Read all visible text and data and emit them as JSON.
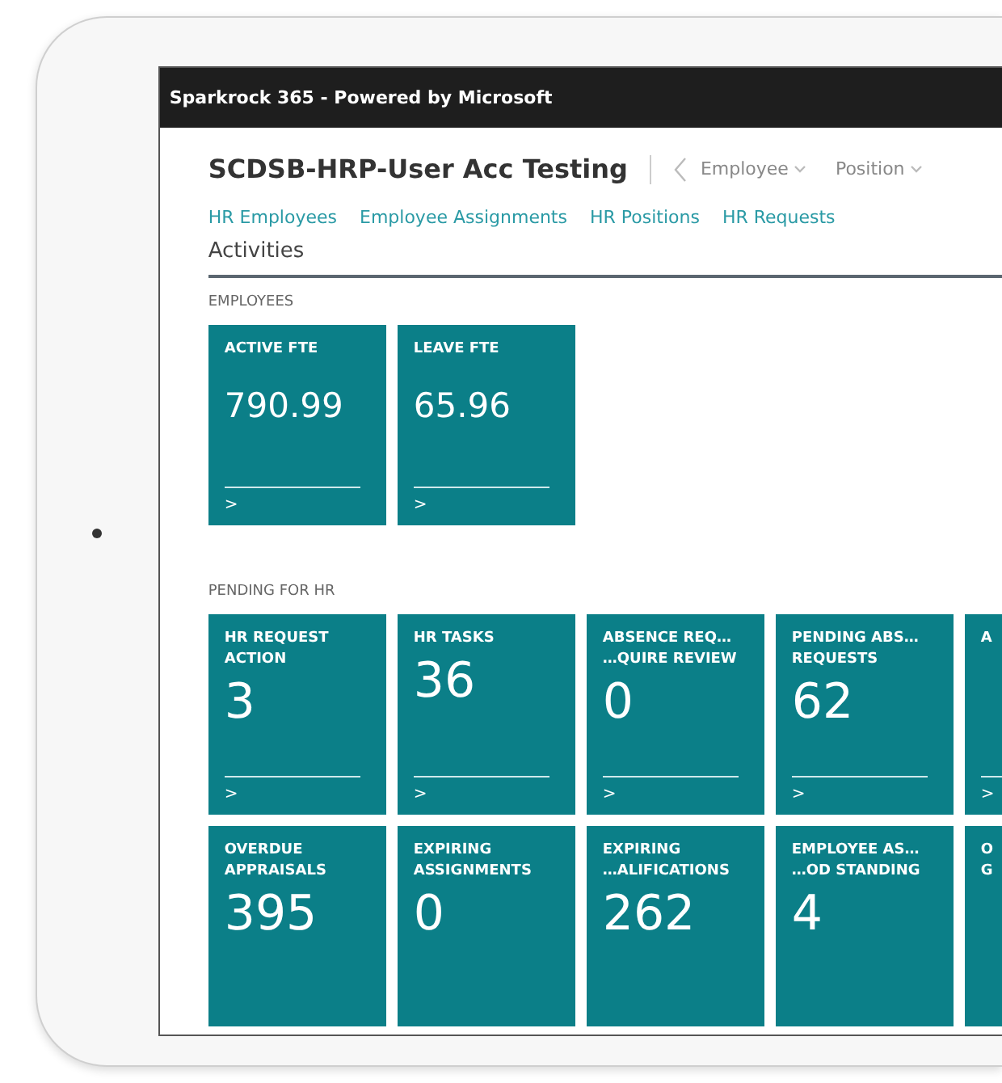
{
  "window": {
    "title": "Sparkrock 365 - Powered by Microsoft"
  },
  "header": {
    "company": "SCDSB-HRP-User Acc Testing",
    "menus": [
      {
        "label": "Employee"
      },
      {
        "label": "Position"
      }
    ]
  },
  "nav_links": [
    "HR Employees",
    "Employee Assignments",
    "HR Positions",
    "HR Requests"
  ],
  "page_title": "Activities",
  "sections": [
    {
      "title": "EMPLOYEES",
      "tiles": [
        {
          "lines": [
            "ACTIVE FTE"
          ],
          "value": "790.99",
          "chevron": ">"
        },
        {
          "lines": [
            "LEAVE FTE"
          ],
          "value": "65.96",
          "chevron": ">"
        }
      ]
    },
    {
      "title": "PENDING FOR HR",
      "tiles": [
        {
          "lines": [
            "HR REQUEST",
            "ACTION"
          ],
          "value": "3",
          "chevron": ">"
        },
        {
          "lines": [
            "HR TASKS"
          ],
          "value": "36",
          "chevron": ">"
        },
        {
          "lines": [
            "ABSENCE REQ…",
            "…QUIRE REVIEW"
          ],
          "value": "0",
          "chevron": ">"
        },
        {
          "lines": [
            "PENDING ABS…",
            "REQUESTS"
          ],
          "value": "62",
          "chevron": ">"
        },
        {
          "lines": [
            "A"
          ],
          "chevron": ">"
        },
        {
          "lines": [
            "OVERDUE",
            "APPRAISALS"
          ],
          "value": "395"
        },
        {
          "lines": [
            "EXPIRING",
            "ASSIGNMENTS"
          ],
          "value": "0"
        },
        {
          "lines": [
            "EXPIRING",
            "…ALIFICATIONS"
          ],
          "value": "262"
        },
        {
          "lines": [
            "EMPLOYEE AS…",
            "…OD STANDING"
          ],
          "value": "4"
        },
        {
          "lines": [
            "O",
            "G"
          ]
        }
      ]
    }
  ]
}
